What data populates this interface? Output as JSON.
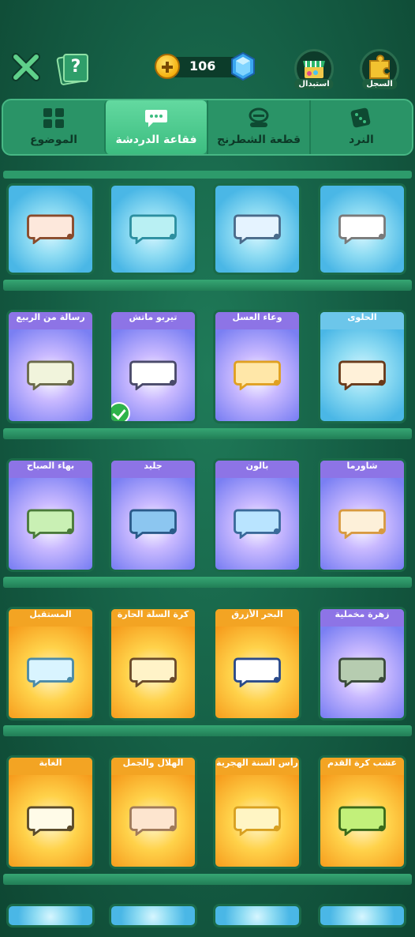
{
  "topbar": {
    "coin_count": "106",
    "exchange_label": "استبدال",
    "record_label": "السجل"
  },
  "tabs": [
    {
      "label": "النرد",
      "icon": "dice-icon"
    },
    {
      "label": "قطعة الشطرنج",
      "icon": "chess-piece-icon"
    },
    {
      "label": "فقاعة الدردشة",
      "icon": "chat-bubble-icon",
      "active": true
    },
    {
      "label": "الموضوع",
      "icon": "grid-icon"
    }
  ],
  "rows": [
    {
      "items": [
        {
          "title": "",
          "theme": "blue",
          "bubble": "#ffffff",
          "border": "#7a7a7a"
        },
        {
          "title": "",
          "theme": "blue",
          "bubble": "#e5f3ff",
          "border": "#4a6a8a"
        },
        {
          "title": "",
          "theme": "blue",
          "bubble": "#b9f0f3",
          "border": "#2c8fa0"
        },
        {
          "title": "",
          "theme": "blue",
          "bubble": "#fde8dc",
          "border": "#8a4a2a"
        }
      ]
    },
    {
      "items": [
        {
          "title": "الحلوى",
          "theme": "blue",
          "bubble": "#fff1d9",
          "border": "#6a3a1a"
        },
        {
          "title": "وعاء العسل",
          "theme": "purple",
          "bubble": "#ffe7a8",
          "border": "#e0a020"
        },
        {
          "title": "تيربو ماتش",
          "theme": "purple",
          "bubble": "#ffffff",
          "border": "#4a4a6a",
          "selected": true
        },
        {
          "title": "رسالة من الربيع",
          "theme": "purple",
          "bubble": "#f1f4dc",
          "border": "#6a6a4a"
        }
      ]
    },
    {
      "items": [
        {
          "title": "شاورما",
          "theme": "purple",
          "bubble": "#fdf0d9",
          "border": "#d89a40"
        },
        {
          "title": "بالون",
          "theme": "purple",
          "bubble": "#b9e4ff",
          "border": "#3a6a9a"
        },
        {
          "title": "جليد",
          "theme": "purple",
          "bubble": "#8cc6f0",
          "border": "#2a5a8a"
        },
        {
          "title": "بهاء الصباح",
          "theme": "purple",
          "bubble": "#c9f0b4",
          "border": "#4a7a3a"
        }
      ]
    },
    {
      "items": [
        {
          "title": "زهرة مخملية",
          "theme": "purple",
          "bubble": "#b6ccb0",
          "border": "#3a4a3a"
        },
        {
          "title": "البحر الأزرق",
          "theme": "orange",
          "bubble": "#ffffff",
          "border": "#2a4a8a"
        },
        {
          "title": "كرة السلة الحارة",
          "theme": "orange",
          "bubble": "#fff3c8",
          "border": "#6a4a2a"
        },
        {
          "title": "المستقبل",
          "theme": "orange",
          "bubble": "#d9f4ff",
          "border": "#4a8aa8"
        }
      ]
    },
    {
      "items": [
        {
          "title": "عشب كرة القدم",
          "theme": "orange",
          "bubble": "#c2f07a",
          "border": "#3a6a1a"
        },
        {
          "title": "رأس السنة الهجرية",
          "theme": "orange",
          "bubble": "#fff5c4",
          "border": "#d8a020"
        },
        {
          "title": "الهلال والجمل",
          "theme": "orange",
          "bubble": "#fde5cf",
          "border": "#a07a5a"
        },
        {
          "title": "الغابة",
          "theme": "orange",
          "bubble": "#fffbe8",
          "border": "#5a4a2a"
        }
      ]
    }
  ]
}
